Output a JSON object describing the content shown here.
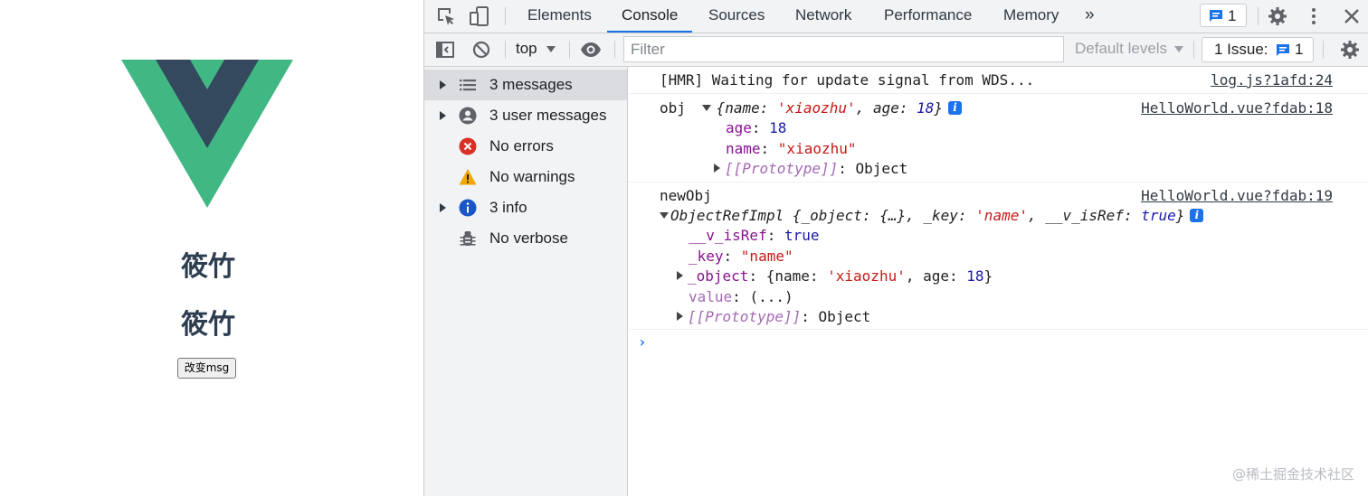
{
  "app": {
    "title_1": "筱竹",
    "title_2": "筱竹",
    "button_label": "改变msg",
    "logo_colors": {
      "outer": "#41b883",
      "inner": "#34495e"
    }
  },
  "devtools": {
    "tabs": [
      "Elements",
      "Console",
      "Sources",
      "Network",
      "Performance",
      "Memory"
    ],
    "active_tab": "Console",
    "more_tabs_icon": "chevron-double-right-icon",
    "issue_chip_count": "1",
    "toolbar": {
      "context": "top",
      "filter_placeholder": "Filter",
      "levels_label": "Default levels",
      "issues_label": "1 Issue:",
      "issues_count": "1"
    },
    "sidebar": [
      {
        "label": "3 messages",
        "icon": "list-icon",
        "expandable": true,
        "selected": true
      },
      {
        "label": "3 user messages",
        "icon": "user-icon",
        "expandable": true,
        "selected": false
      },
      {
        "label": "No errors",
        "icon": "error-icon",
        "expandable": false,
        "selected": false
      },
      {
        "label": "No warnings",
        "icon": "warning-icon",
        "expandable": false,
        "selected": false
      },
      {
        "label": "3 info",
        "icon": "info-icon",
        "expandable": true,
        "selected": false
      },
      {
        "label": "No verbose",
        "icon": "bug-icon",
        "expandable": false,
        "selected": false
      }
    ],
    "console": {
      "msg1": {
        "text": "[HMR] Waiting for update signal from WDS...",
        "source": "log.js?1afd:24"
      },
      "msg2": {
        "label": "obj",
        "preview_name_key": "name",
        "preview_name_val": "'xiaozhu'",
        "preview_age_key": "age",
        "preview_age_val": "18",
        "age_key": "age",
        "age_val": "18",
        "name_key": "name",
        "name_val": "\"xiaozhu\"",
        "proto_key": "[[Prototype]]",
        "proto_val": "Object",
        "source": "HelloWorld.vue?fdab:18"
      },
      "msg3": {
        "label": "newObj",
        "class_name": "ObjectRefImpl",
        "p_object_key": "_object",
        "p_object_val": "{…}",
        "p_key_key": "_key",
        "p_key_val": "'name'",
        "p_isref_key": "__v_isRef",
        "p_isref_val": "true",
        "isref_key": "__v_isRef",
        "isref_val": "true",
        "key_key": "_key",
        "key_val": "\"name\"",
        "object_key": "_object",
        "object_name_key": "name",
        "object_name_val": "'xiaozhu'",
        "object_age_key": "age",
        "object_age_val": "18",
        "value_key": "value",
        "value_val": "(...)",
        "proto_key": "[[Prototype]]",
        "proto_val": "Object",
        "source": "HelloWorld.vue?fdab:19"
      },
      "prompt": "›"
    }
  },
  "watermark": "@稀土掘金技术社区"
}
